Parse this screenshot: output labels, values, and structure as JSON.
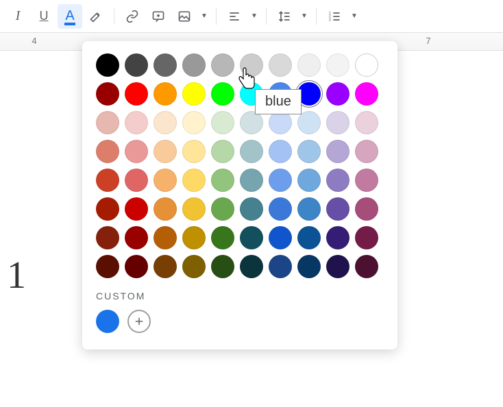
{
  "toolbar": {
    "italic": "I",
    "underline": "U",
    "text_color": "A"
  },
  "ruler": {
    "marks": [
      "4",
      "7"
    ]
  },
  "document": {
    "content": "1"
  },
  "color_picker": {
    "tooltip": "blue",
    "custom_label": "CUSTOM",
    "custom_colors": [
      "#1a73e8"
    ],
    "grid": [
      [
        "#000000",
        "#434343",
        "#666666",
        "#999999",
        "#b7b7b7",
        "#cccccc",
        "#d9d9d9",
        "#efefef",
        "#f3f3f3",
        "#ffffff"
      ],
      [
        "#980000",
        "#ff0000",
        "#ff9900",
        "#ffff00",
        "#00ff00",
        "#00ffff",
        "#4a86e8",
        "#0000ff",
        "#9900ff",
        "#ff00ff"
      ],
      [
        "#e6b8af",
        "#f4cccc",
        "#fce5cd",
        "#fff2cc",
        "#d9ead3",
        "#d0e0e3",
        "#c9daf8",
        "#cfe2f3",
        "#d9d2e9",
        "#ead1dc"
      ],
      [
        "#dd7e6b",
        "#ea9999",
        "#f9cb9c",
        "#ffe599",
        "#b6d7a8",
        "#a2c4c9",
        "#a4c2f4",
        "#9fc5e8",
        "#b4a7d6",
        "#d5a6bd"
      ],
      [
        "#cc4125",
        "#e06666",
        "#f6b26b",
        "#ffd966",
        "#93c47d",
        "#76a5af",
        "#6d9eeb",
        "#6fa8dc",
        "#8e7cc3",
        "#c27ba0"
      ],
      [
        "#a61c00",
        "#cc0000",
        "#e69138",
        "#f1c232",
        "#6aa84f",
        "#45818e",
        "#3c78d8",
        "#3d85c6",
        "#674ea7",
        "#a64d79"
      ],
      [
        "#85200c",
        "#990000",
        "#b45f06",
        "#bf9000",
        "#38761d",
        "#134f5c",
        "#1155cc",
        "#0b5394",
        "#351c75",
        "#741b47"
      ],
      [
        "#5b0f00",
        "#660000",
        "#783f04",
        "#7f6000",
        "#274e13",
        "#0c343d",
        "#1c4587",
        "#073763",
        "#20124d",
        "#4c1130"
      ]
    ],
    "hover_row": 1,
    "hover_col": 7
  }
}
